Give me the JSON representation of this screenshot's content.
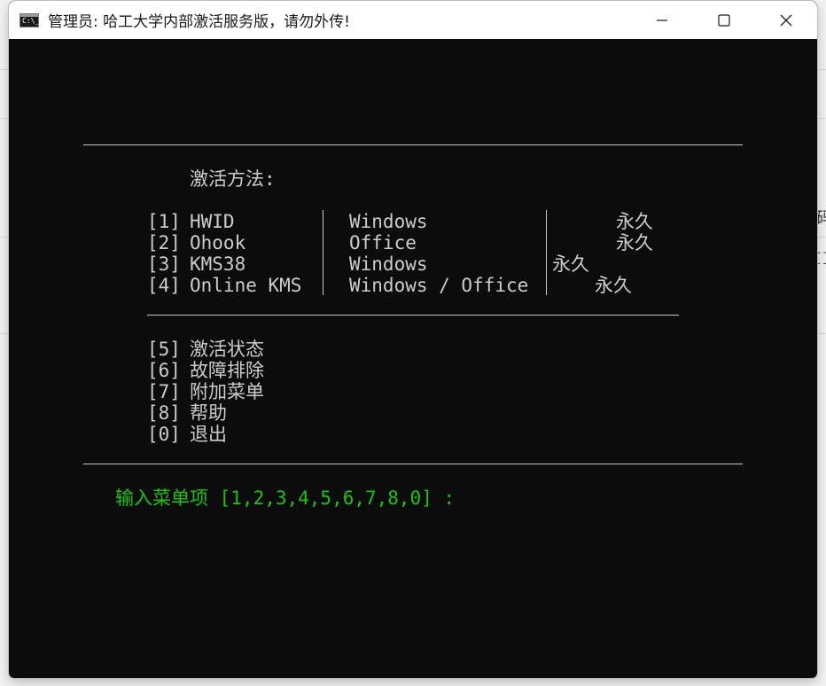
{
  "window": {
    "title": "管理员:  哈工大学内部激活服务版，请勿外传!",
    "icon_text": "C:\\_"
  },
  "background": {
    "glyph_top": "码",
    "glyph_bottom": "⛶"
  },
  "console": {
    "section_title": "激活方法:",
    "methods": [
      {
        "key": "[1]",
        "name": "HWID",
        "target": "Windows",
        "duration": "永久"
      },
      {
        "key": "[2]",
        "name": "Ohook",
        "target": "Office",
        "duration": "永久"
      },
      {
        "key": "[3]",
        "name": "KMS38",
        "target": "Windows",
        "duration": "永久"
      },
      {
        "key": "[4]",
        "name": "Online KMS",
        "target": "Windows / Office",
        "duration": "永久"
      }
    ],
    "menu": [
      {
        "key": "[5]",
        "label": "激活状态"
      },
      {
        "key": "[6]",
        "label": "故障排除"
      },
      {
        "key": "[7]",
        "label": "附加菜单"
      },
      {
        "key": "[8]",
        "label": "帮助"
      },
      {
        "key": "[0]",
        "label": "退出"
      }
    ],
    "prompt": "输入菜单项 [1,2,3,4,5,6,7,8,0] :"
  },
  "colors": {
    "console_bg": "#0c0c0c",
    "console_text": "#cccccc",
    "prompt_green": "#16c60c"
  }
}
